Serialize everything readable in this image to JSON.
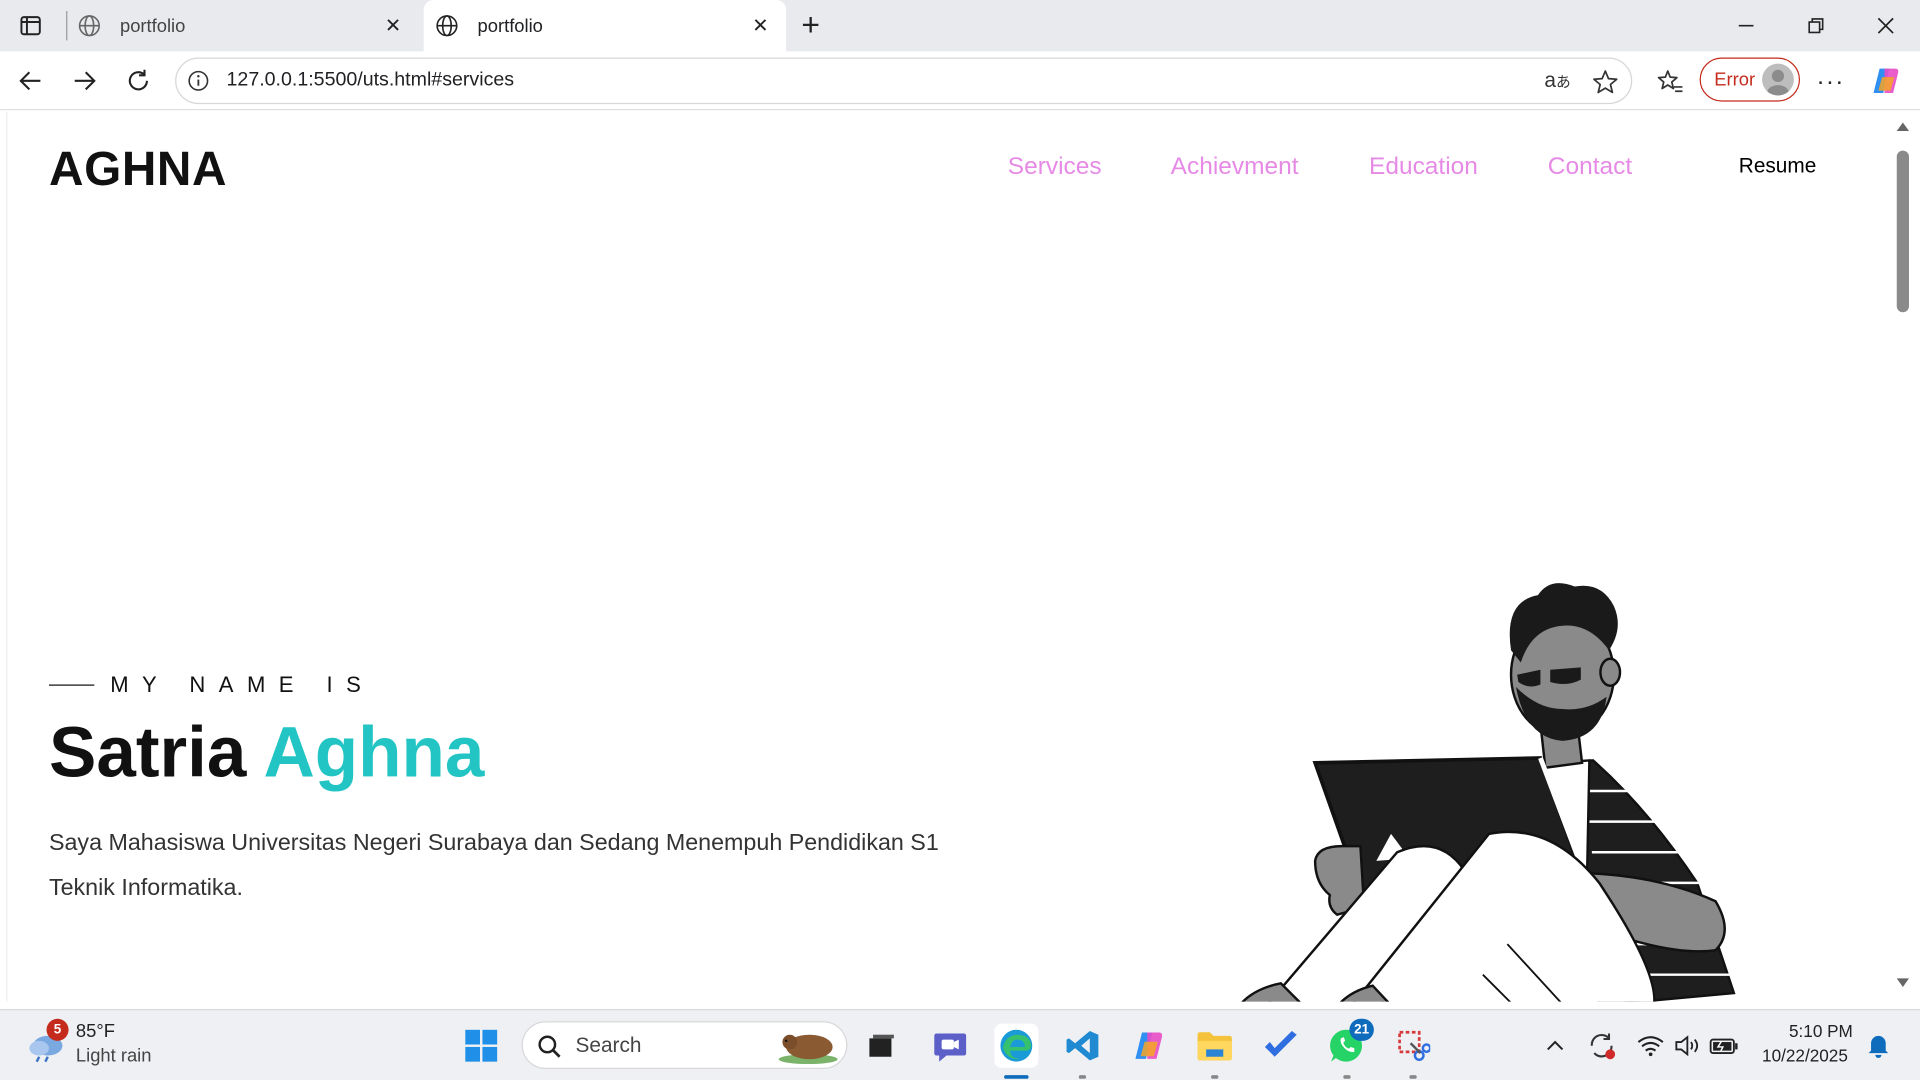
{
  "browser": {
    "tabs": [
      {
        "title": "portfolio",
        "active": false
      },
      {
        "title": "portfolio",
        "active": true
      }
    ],
    "url": "127.0.0.1:5500/uts.html#services",
    "profile_status": "Error"
  },
  "page": {
    "logo": "AGHNA",
    "nav": {
      "services": "Services",
      "achievment": "Achievment",
      "education": "Education",
      "contact": "Contact",
      "resume": "Resume"
    },
    "hero": {
      "kicker": "MY NAME IS",
      "first_name": "Satria",
      "last_name": "Aghna",
      "description": "Saya Mahasiswa Universitas Negeri Surabaya dan Sedang Menempuh Pendidikan S1 Teknik Informatika."
    }
  },
  "taskbar": {
    "weather": {
      "temp": "85°F",
      "desc": "Light rain",
      "badge": "5"
    },
    "search_label": "Search",
    "whatsapp_badge": "21",
    "time": "5:10 PM",
    "date": "10/22/2025"
  },
  "colors": {
    "accent": "#22c4c4",
    "nav_link": "#e68ae6",
    "error": "#c42b1c"
  }
}
